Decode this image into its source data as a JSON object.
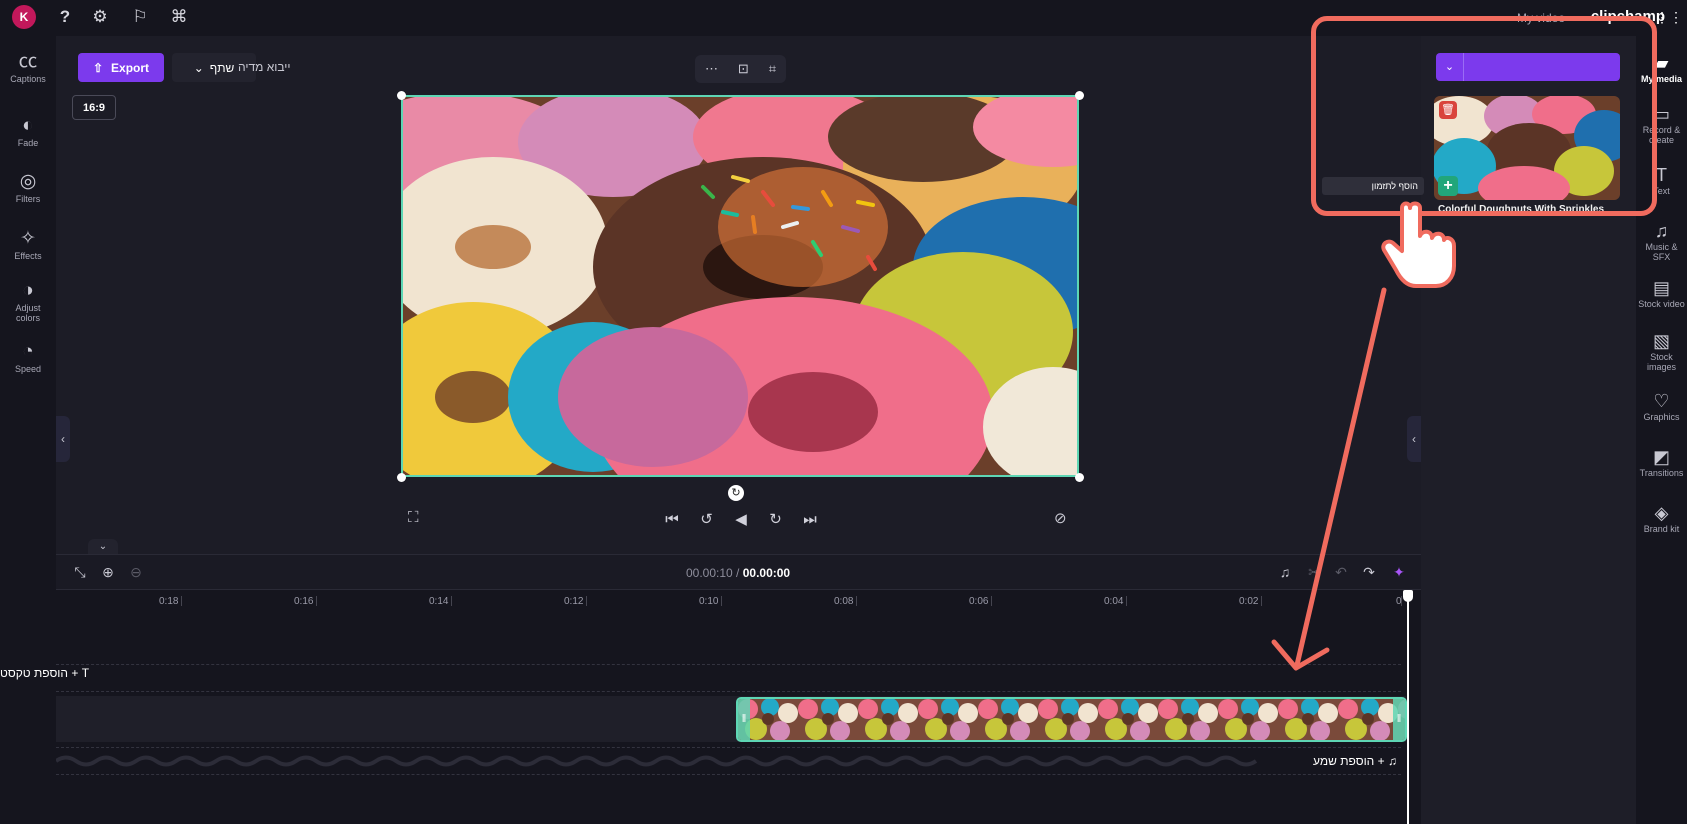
{
  "topbar": {
    "avatar_letter": "K",
    "brand": "clipchamp",
    "project_name": "My video"
  },
  "left_rail": [
    {
      "name": "captions",
      "label": "Captions"
    },
    {
      "name": "fade",
      "label": "Fade"
    },
    {
      "name": "filters",
      "label": "Filters"
    },
    {
      "name": "effects",
      "label": "Effects"
    },
    {
      "name": "adjust-colors",
      "label": "Adjust colors"
    },
    {
      "name": "speed",
      "label": "Speed"
    }
  ],
  "stage": {
    "export_label": "Export",
    "share_label": "שתף",
    "import_text": "ייבוא מדיה",
    "aspect_ratio": "16:9"
  },
  "timeline": {
    "time_current": "00.00:00",
    "time_total": "00.00:10",
    "ticks": [
      "0",
      "0:02",
      "0:04",
      "0:06",
      "0:08",
      "0:10",
      "0:12",
      "0:14",
      "0:16",
      "0:18"
    ],
    "text_track_label": "הוספת טקסט + T",
    "audio_track_label": "הוספת שמע + ♫"
  },
  "media_panel": {
    "add_tooltip": "הוסף לתזמון",
    "media_title": "Colorful Doughnuts With Sprinkles"
  },
  "right_rail": [
    {
      "name": "my-media",
      "label": "My media",
      "active": true
    },
    {
      "name": "record-create",
      "label": "Record & create"
    },
    {
      "name": "text",
      "label": "Text"
    },
    {
      "name": "music-sfx",
      "label": "Music & SFX"
    },
    {
      "name": "stock-video",
      "label": "Stock video"
    },
    {
      "name": "stock-images",
      "label": "Stock images"
    },
    {
      "name": "graphics",
      "label": "Graphics"
    },
    {
      "name": "transitions",
      "label": "Transitions"
    },
    {
      "name": "brand-kit",
      "label": "Brand kit"
    }
  ],
  "colors": {
    "accent": "#7c3aed",
    "selection": "#5ed6b4",
    "annotation": "#f06b5e",
    "add_button": "#21a67a",
    "delete_button": "#d9443c"
  }
}
